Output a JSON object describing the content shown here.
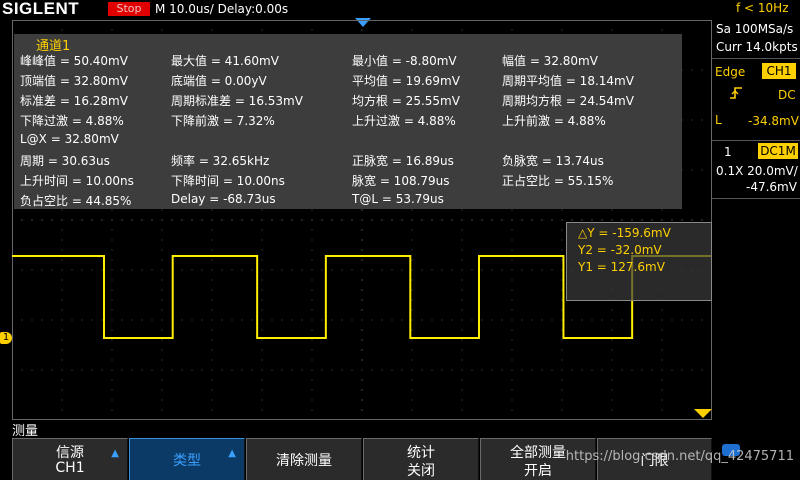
{
  "header": {
    "brand": "SIGLENT",
    "run_state": "Stop",
    "timebase": "M 10.0us/  Delay:0.00s",
    "trigger_frequency": "f < 10Hz"
  },
  "measurements": {
    "title": "通道1",
    "rows": [
      [
        "峰峰值 = 50.40mV",
        "最大值 = 41.60mV",
        "最小值 = -8.80mV",
        "幅值 = 32.80mV"
      ],
      [
        "顶端值 = 32.80mV",
        "底端值 = 0.00yV",
        "平均值 = 19.69mV",
        "周期平均值 = 18.14mV"
      ],
      [
        "标准差 = 16.28mV",
        "周期标准差 = 16.53mV",
        "均方根 = 25.55mV",
        "周期均方根 = 24.54mV"
      ],
      [
        "下降过激 = 4.88%",
        "下降前激 = 7.32%",
        "上升过激 = 4.88%",
        "上升前激 = 4.88%"
      ],
      [
        "L@X = 32.80mV",
        "",
        "",
        ""
      ],
      [
        "周期 = 30.63us",
        "频率 = 32.65kHz",
        "正脉宽 = 16.89us",
        "负脉宽 = 13.74us"
      ],
      [
        "上升时间 = 10.00ns",
        "下降时间 = 10.00ns",
        "脉宽 = 108.79us",
        "正占空比 = 55.15%"
      ],
      [
        "负占空比 = 44.85%",
        "Delay = -68.73us",
        "T@L = 53.79us",
        ""
      ]
    ]
  },
  "cursors": {
    "delta_y": "△Y = -159.6mV",
    "y2": "Y2 = -32.0mV",
    "y1": "Y1 = 127.6mV"
  },
  "right_panel": {
    "sample_rate": "Sa 100MSa/s",
    "memory_depth": "Curr 14.0kpts",
    "trigger_type": "Edge",
    "trigger_source": "CH1",
    "coupling": "DC",
    "trigger_level_label": "L",
    "trigger_level": "-34.8mV",
    "channel_number": "1",
    "channel_coupling": "DC1M",
    "probe_scale": "0.1X 20.0mV/",
    "channel_offset": "-47.6mV"
  },
  "waveform": {
    "channel_marker": "1",
    "color": "#ffee00",
    "high_level_mV": 32.8,
    "low_level_mV": 0,
    "period_us": 30.63,
    "positive_width_us": 16.89
  },
  "menu": {
    "title": "测量",
    "softkeys": [
      {
        "line1": "信源",
        "line2": "CH1"
      },
      {
        "line1": "类型",
        "line2": ""
      },
      {
        "line1": "清除测量",
        "line2": ""
      },
      {
        "line1": "统计",
        "line2": "关闭"
      },
      {
        "line1": "全部测量",
        "line2": "开启"
      },
      {
        "line1": "门限",
        "line2": ""
      }
    ]
  },
  "watermark": "https://blog.csdn.net/qq_42475711",
  "colors": {
    "accent_yellow": "#ffd000",
    "stop_red": "#e00000",
    "softkey_selected": "#0b3a66",
    "softkey_blue_text": "#3aa0ff"
  }
}
